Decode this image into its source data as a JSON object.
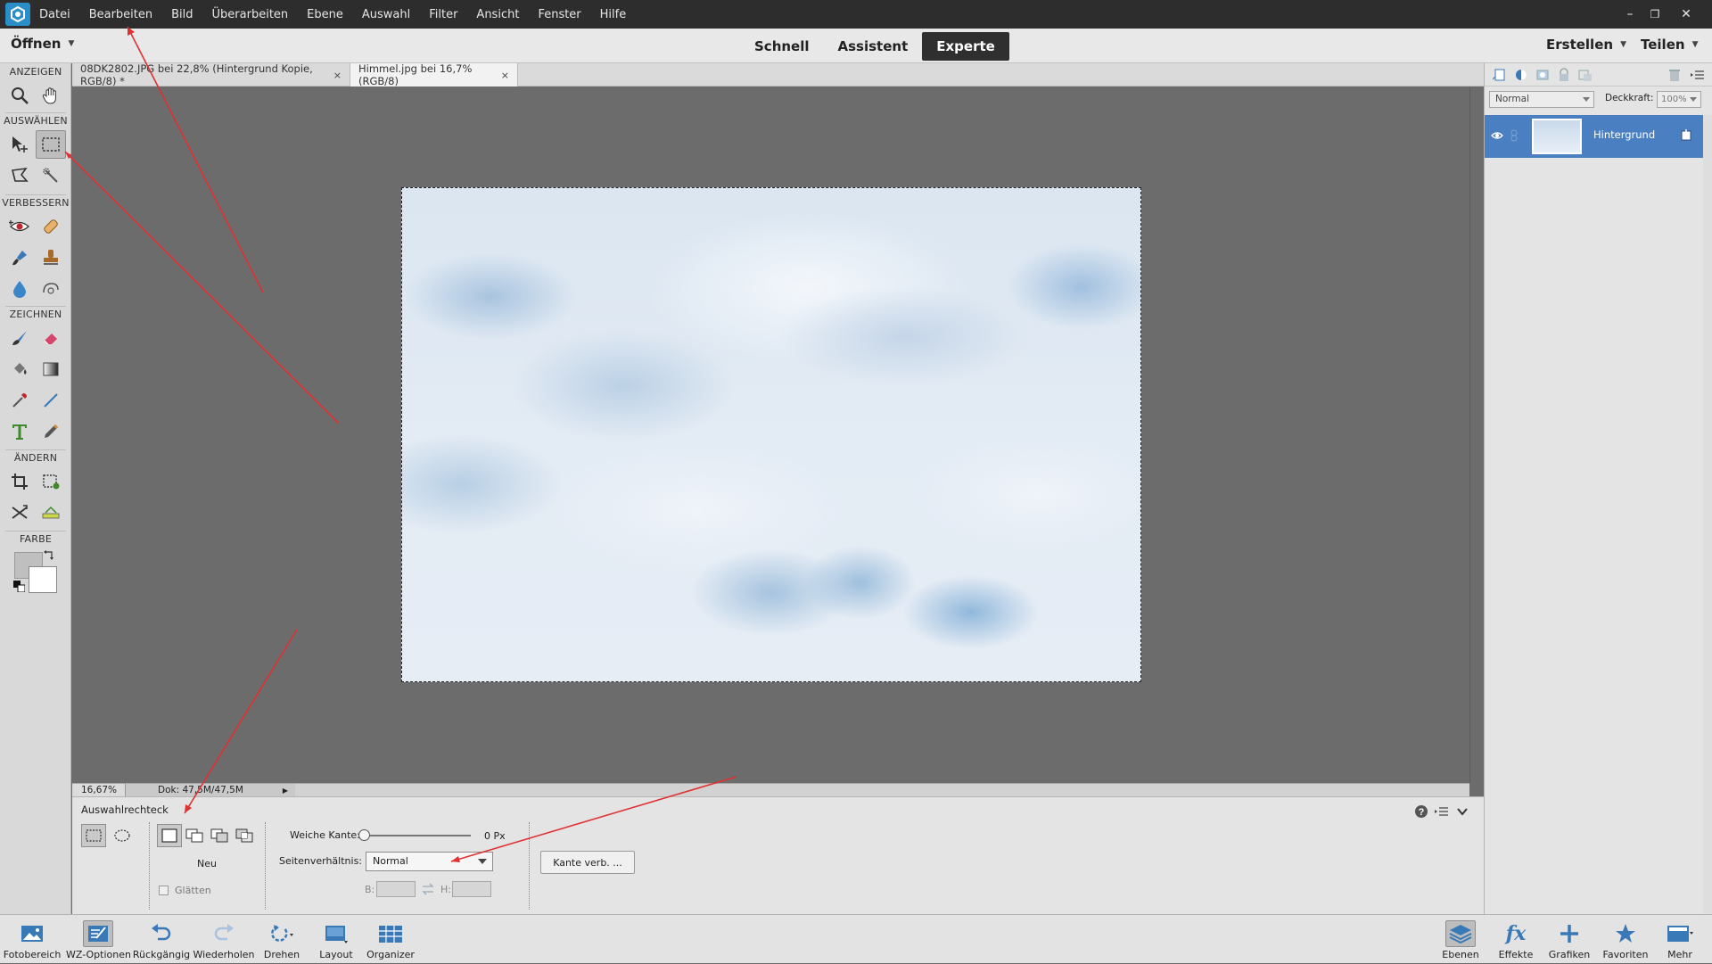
{
  "menubar": {
    "items": [
      "Datei",
      "Bearbeiten",
      "Bild",
      "Überarbeiten",
      "Ebene",
      "Auswahl",
      "Filter",
      "Ansicht",
      "Fenster",
      "Hilfe"
    ],
    "minimize": "–",
    "restore": "❐",
    "close": "✕"
  },
  "modebar": {
    "open_label": "Öffnen",
    "modes": [
      "Schnell",
      "Assistent",
      "Experte"
    ],
    "active_mode": "Experte",
    "create_label": "Erstellen",
    "share_label": "Teilen"
  },
  "toolbox": {
    "sections": [
      "ANZEIGEN",
      "AUSWÄHLEN",
      "VERBESSERN",
      "ZEICHNEN",
      "ÄNDERN",
      "FARBE"
    ]
  },
  "tabs": [
    {
      "label": "08DK2802.JPG bei 22,8% (Hintergrund Kopie, RGB/8) *",
      "close": "×"
    },
    {
      "label": "Himmel.jpg bei 16,7% (RGB/8)",
      "close": "×",
      "active": true
    }
  ],
  "status": {
    "zoom": "16,67%",
    "doc": "Dok: 47,5M/47,5M"
  },
  "options": {
    "tool_name": "Auswahlrechteck",
    "mode_label": "Neu",
    "smooth_label": "Glätten",
    "feather_label": "Weiche Kante:",
    "feather_value": "0 Px",
    "ratio_label": "Seitenverhältnis:",
    "ratio_value": "Normal",
    "width_label": "B:",
    "height_label": "H:",
    "refine_label": "Kante verb. ..."
  },
  "layers": {
    "blend_mode": "Normal",
    "opacity_label": "Deckkraft:",
    "opacity_value": "100%",
    "items": [
      {
        "name": "Hintergrund"
      }
    ]
  },
  "taskbar": {
    "left": [
      "Fotobereich",
      "WZ-Optionen",
      "Rückgängig",
      "Wiederholen",
      "Drehen",
      "Layout",
      "Organizer"
    ],
    "right": [
      "Ebenen",
      "Effekte",
      "Grafiken",
      "Favoriten",
      "Mehr"
    ]
  },
  "colors": {
    "accent": "#4a7fc1",
    "logo": "#2a8fc8",
    "annotation": "#e03030"
  }
}
